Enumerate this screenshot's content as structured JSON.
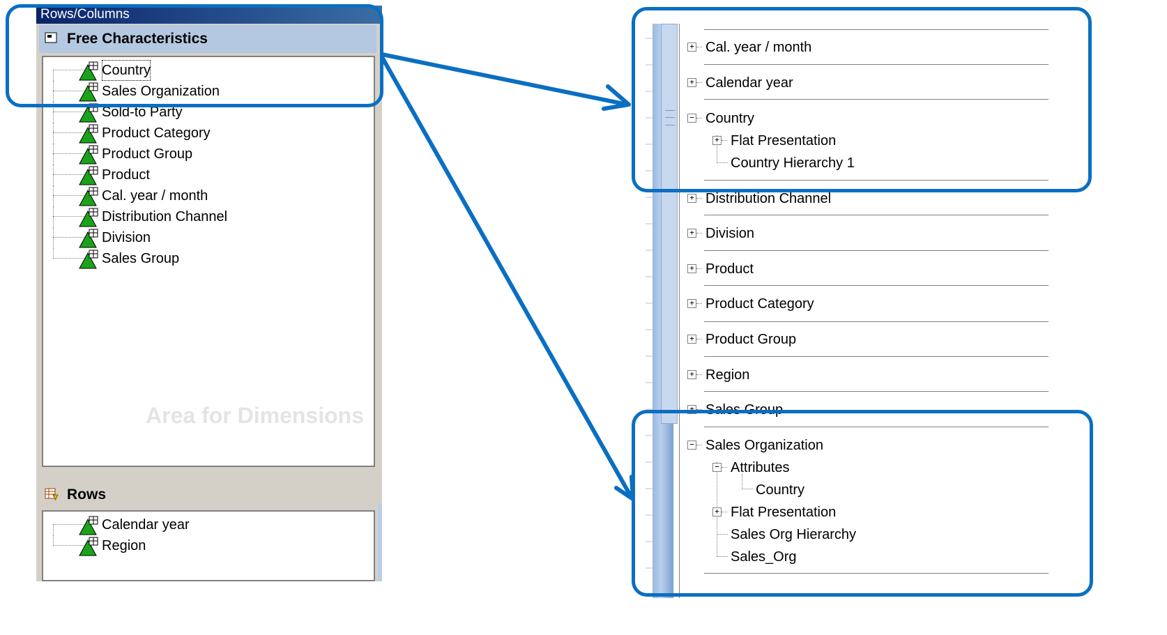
{
  "left_panel": {
    "title": "Rows/Columns",
    "free_header": "Free Characteristics",
    "free_items": [
      {
        "label": "Country"
      },
      {
        "label": "Sales Organization"
      },
      {
        "label": "Sold-to Party"
      },
      {
        "label": "Product Category"
      },
      {
        "label": "Product Group"
      },
      {
        "label": "Product"
      },
      {
        "label": "Cal. year / month"
      },
      {
        "label": "Distribution Channel"
      },
      {
        "label": "Division"
      },
      {
        "label": "Sales Group"
      }
    ],
    "watermark": "Area for Dimensions",
    "rows_header": "Rows",
    "rows_items": [
      {
        "label": "Calendar year"
      },
      {
        "label": "Region"
      }
    ]
  },
  "right_panel": {
    "nodes": [
      {
        "label": "Cal. year / month",
        "expander": "+"
      },
      {
        "label": "Calendar year",
        "expander": "+"
      },
      {
        "label": "Country",
        "expander": "−",
        "children": [
          {
            "label": "Flat Presentation",
            "expander": "+"
          },
          {
            "label": "Country Hierarchy 1"
          }
        ]
      },
      {
        "label": "Distribution Channel",
        "expander": "+"
      },
      {
        "label": "Division",
        "expander": "+"
      },
      {
        "label": "Product",
        "expander": "+"
      },
      {
        "label": "Product Category",
        "expander": "+"
      },
      {
        "label": "Product Group",
        "expander": "+"
      },
      {
        "label": "Region",
        "expander": "+"
      },
      {
        "label": "Sales Group",
        "expander": "+"
      },
      {
        "label": "Sales Organization",
        "expander": "−",
        "children": [
          {
            "label": "Attributes",
            "expander": "−",
            "children": [
              {
                "label": "Country"
              }
            ]
          },
          {
            "label": "Flat Presentation",
            "expander": "+"
          },
          {
            "label": "Sales Org Hierarchy"
          },
          {
            "label": "Sales_Org"
          }
        ]
      }
    ]
  },
  "colors": {
    "callout": "#0a6fc2",
    "title_bar": "#0a246a",
    "free_header_bg": "#b5c8e1",
    "dim_icon_green": "#1aa31a"
  },
  "icons": {
    "dimension": "green-triangle-grid-icon",
    "free_header": "panel-icon",
    "rows_header": "rows-table-icon",
    "expand": "plus-box-icon",
    "collapse": "minus-box-icon"
  }
}
